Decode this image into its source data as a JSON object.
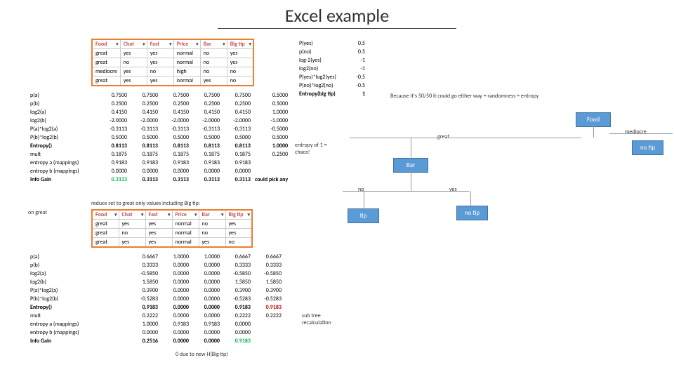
{
  "title": "Excel example",
  "table1": {
    "headers": [
      "Food",
      "Chat",
      "Fast",
      "Price",
      "Bar",
      "Big tip"
    ],
    "rows": [
      [
        "great",
        "yes",
        "yes",
        "normal",
        "no",
        "yes"
      ],
      [
        "great",
        "no",
        "yes",
        "normal",
        "no",
        "yes"
      ],
      [
        "mediocre",
        "yes",
        "no",
        "high",
        "no",
        "no"
      ],
      [
        "great",
        "yes",
        "yes",
        "normal",
        "yes",
        "no"
      ]
    ]
  },
  "stats1": {
    "rows": [
      [
        "p(a)",
        "0.7500",
        "0.7500",
        "0.7500",
        "0.7500",
        "0.7500",
        "0.5000"
      ],
      [
        "p(b)",
        "0.2500",
        "0.2500",
        "0.2500",
        "0.2500",
        "0.2500",
        "0.5000"
      ],
      [
        "log2(a)",
        "0.4150",
        "0.4150",
        "0.4150",
        "0.4150",
        "0.4150",
        "1.0000"
      ],
      [
        "log2(b)",
        "-2.0000",
        "-2.0000",
        "-2.0000",
        "-2.0000",
        "-2.0000",
        "-1.0000"
      ],
      [
        "P(a)*log2(a)",
        "-0.3113",
        "-0.3113",
        "-0.3113",
        "-0.3113",
        "-0.3113",
        "-0.5000"
      ],
      [
        "P(b)*log2(b)",
        "0.5000",
        "0.5000",
        "0.5000",
        "0.5000",
        "0.5000",
        "0.5000"
      ],
      [
        "Entropy()",
        "0.8113",
        "0.8113",
        "0.8113",
        "0.8113",
        "0.8113",
        "1.0000"
      ],
      [
        "mult",
        "0.1875",
        "0.1875",
        "0.1875",
        "0.1875",
        "0.1875",
        "0.2500"
      ],
      [
        "entropy a (mappings)",
        "0.9183",
        "0.9183",
        "0.9183",
        "0.9183",
        "0.9183",
        ""
      ],
      [
        "entropy b (mappings)",
        "0.0000",
        "0.0000",
        "0.0000",
        "0.0000",
        "0.0000",
        ""
      ],
      [
        "Info Gain",
        "0.3113",
        "0.3113",
        "0.3113",
        "0.3113",
        "0.3113",
        "could pick any"
      ]
    ]
  },
  "entropy_note": "entropy of 1 = chaos!",
  "side_calc": {
    "rows": [
      [
        "P(yes)",
        "0.5"
      ],
      [
        "p(no)",
        "0.5"
      ],
      [
        "log-2(yes)",
        "-1"
      ],
      [
        "log2(no)",
        "-1"
      ],
      [
        "P(yes)*log2(yes)",
        "-0.5"
      ],
      [
        "P(no)*log2(no)",
        "-0.5"
      ],
      [
        "Entropy(big tip)",
        "1"
      ]
    ]
  },
  "side_note": "Because it's 50/50 it could go either way = randomness = entropy",
  "reduce_label": "reduce set to great only values including Big tip:",
  "on_great": "on great",
  "table2": {
    "headers": [
      "Food",
      "Chat",
      "Fast",
      "Price",
      "Bar",
      "Big tip"
    ],
    "rows": [
      [
        "great",
        "yes",
        "yes",
        "normal",
        "no",
        "yes"
      ],
      [
        "great",
        "no",
        "yes",
        "normal",
        "no",
        "yes"
      ],
      [
        "great",
        "yes",
        "yes",
        "normal",
        "yes",
        "no"
      ]
    ]
  },
  "stats2": {
    "rows": [
      [
        "p(a)",
        "",
        "0.6667",
        "1.0000",
        "1.0000",
        "0.6667",
        "0.6667"
      ],
      [
        "p(b)",
        "",
        "0.3333",
        "0.0000",
        "0.0000",
        "0.3333",
        "0.3333"
      ],
      [
        "log2(a)",
        "",
        "-0.5850",
        "0.0000",
        "0.0000",
        "-0.5850",
        "-0.5850"
      ],
      [
        "log2(b)",
        "",
        "1.5850",
        "0.0000",
        "0.0000",
        "1.5850",
        "1.5850"
      ],
      [
        "P(a)*log2(a)",
        "",
        "0.3900",
        "0.0000",
        "0.0000",
        "0.3900",
        "0.3900"
      ],
      [
        "P(b)*log2(b)",
        "",
        "-0.5283",
        "0.0000",
        "0.0000",
        "-0.5283",
        "-0.5283"
      ],
      [
        "Entropy()",
        "",
        "0.9183",
        "0.0000",
        "0.0000",
        "0.9183",
        "0.9183"
      ],
      [
        "mult",
        "",
        "0.2222",
        "0.0000",
        "0.0000",
        "0.2222",
        "0.2222"
      ],
      [
        "entropy a (mappings)",
        "",
        "1.0000",
        "0.9183",
        "0.9183",
        "0.0000",
        ""
      ],
      [
        "entropy b (mappings)",
        "",
        "0.0000",
        "0.0000",
        "0.0000",
        "0.0000",
        ""
      ],
      [
        "Info Gain",
        "",
        "0.2516",
        "0.0000",
        "0.0000",
        "0.9183",
        ""
      ]
    ]
  },
  "sub_tree_note": "sub tree recalculation",
  "bottom_note": "0 due to new H(Big tip)",
  "tree": {
    "food": "Food",
    "bar": "Bar",
    "tip": "tip",
    "no_tip1": "no tip",
    "no_tip2": "no tip",
    "great": "great",
    "mediocre": "mediocre",
    "no": "no",
    "yes": "yes"
  }
}
